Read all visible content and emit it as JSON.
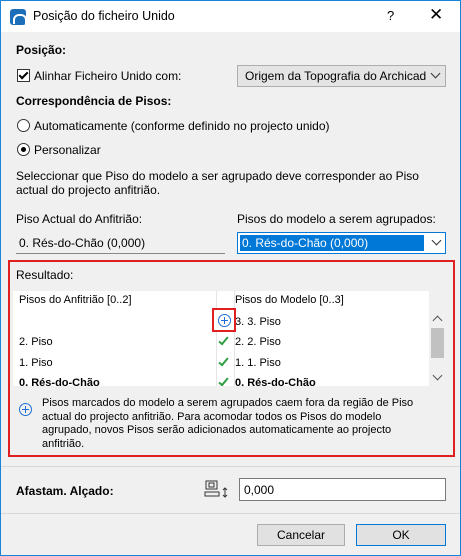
{
  "window": {
    "title": "Posição do ficheiro Unido",
    "help": "?",
    "close": "✕"
  },
  "position": {
    "heading": "Posição:",
    "align_label": "Alinhar Ficheiro Unido com:",
    "align_checked": true,
    "align_value": "Origem da Topografia do Archicad"
  },
  "story_match": {
    "heading": "Correspondência de Pisos:",
    "options": [
      "Automaticamente (conforme definido no projecto unido)",
      "Personalizar"
    ],
    "selected_index": 1,
    "description": "Seleccionar que Piso do modelo a ser agrupado deve corresponder ao Piso actual do projecto anfitrião.",
    "host_label": "Piso Actual do Anfitrião:",
    "host_value": "0. Rés-do-Chão (0,000)",
    "model_label": "Pisos do modelo a serem agrupados:",
    "model_value": "0. Rés-do-Chão (0,000)"
  },
  "result": {
    "heading": "Resultado:",
    "col_host": "Pisos do Anfitrião [0..2]",
    "col_model": "Pisos do Modelo [0..3]",
    "rows": [
      {
        "host": "",
        "status": "plus-icon",
        "model": "3. 3. Piso"
      },
      {
        "host": "2. Piso",
        "status": "check-icon",
        "model": "2. 2. Piso"
      },
      {
        "host": "1. Piso",
        "status": "check-icon",
        "model": "1. 1. Piso"
      },
      {
        "host": "0. Rés-do-Chão",
        "status": "check-icon",
        "model": "0. Rés-do-Chão"
      }
    ],
    "info": "Pisos marcados do modelo a serem agrupados caem fora da região de Piso actual do projecto anfitrião. Para acomodar todos os Pisos do modelo agrupado, novos Pisos serão adicionados automaticamente ao projecto anfitrião."
  },
  "elevation": {
    "label": "Afastam. Alçado:",
    "value": "0,000"
  },
  "buttons": {
    "cancel": "Cancelar",
    "ok": "OK"
  },
  "colors": {
    "accent": "#0078d7",
    "highlight_border": "#e02020",
    "check": "#2ea043"
  }
}
